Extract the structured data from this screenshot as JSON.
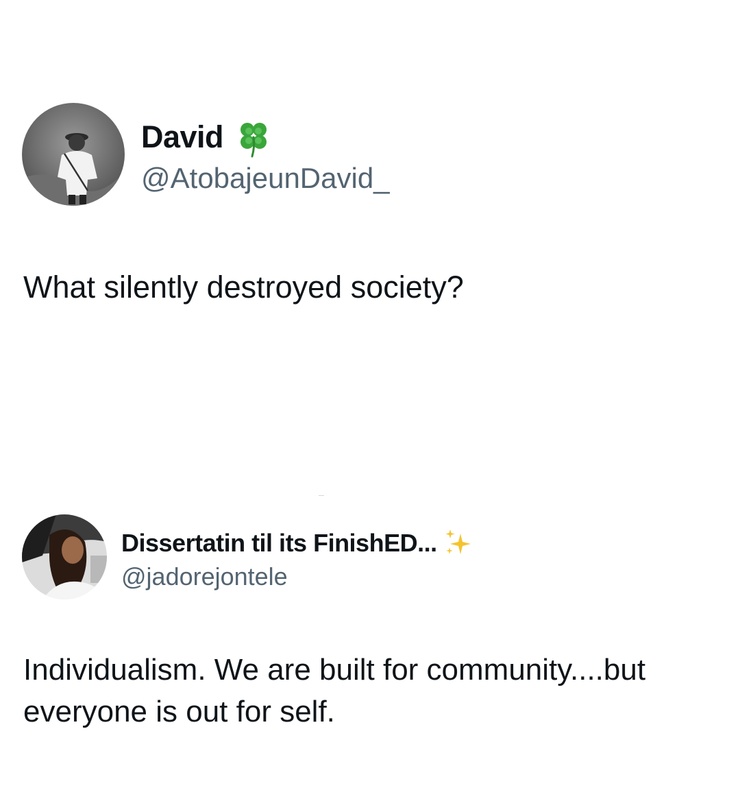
{
  "posts": [
    {
      "display_name": "David",
      "name_emoji": "four-leaf-clover-icon",
      "handle": "@AtobajeunDavid_",
      "text": "What silently destroyed society?"
    },
    {
      "display_name": "Dissertatin til its FinishED...",
      "name_emoji": "sparkles-icon",
      "handle": "@jadorejontele",
      "text": "Individualism. We are built for community....but everyone is out for self."
    }
  ],
  "colors": {
    "text": "#0f1419",
    "handle": "#536471",
    "clover": "#3aa63a",
    "sparkles": "#f4c430"
  }
}
